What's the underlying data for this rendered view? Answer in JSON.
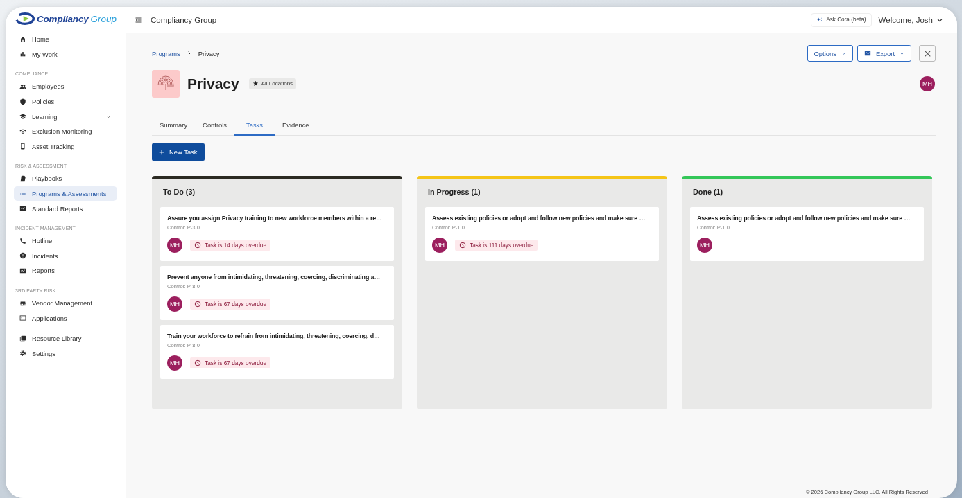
{
  "logo": {
    "word_1": "Compliancy",
    "word_2": "Group"
  },
  "sidebar": {
    "sections": [
      {
        "items": [
          {
            "label": "Home",
            "selected": false
          },
          {
            "label": "My Work",
            "selected": false
          }
        ]
      },
      {
        "heading": "COMPLIANCE",
        "items": [
          {
            "label": "Employees",
            "selected": false
          },
          {
            "label": "Policies",
            "selected": false
          },
          {
            "label": "Learning",
            "selected": false,
            "expanded": false
          },
          {
            "label": "Exclusion Monitoring",
            "selected": false
          },
          {
            "label": "Asset Tracking",
            "selected": false
          }
        ]
      },
      {
        "heading": "RISK & ASSESSMENT",
        "items": [
          {
            "label": "Playbooks",
            "selected": false
          },
          {
            "label": "Programs & Assessments",
            "selected": true
          },
          {
            "label": "Standard Reports",
            "selected": false
          }
        ]
      },
      {
        "heading": "INCIDENT MANAGEMENT",
        "items": [
          {
            "label": "Hotline",
            "selected": false
          },
          {
            "label": "Incidents",
            "selected": false
          },
          {
            "label": "Reports",
            "selected": false
          }
        ]
      },
      {
        "heading": "3RD PARTY RISK",
        "items": [
          {
            "label": "Vendor Management",
            "selected": false
          },
          {
            "label": "Applications",
            "selected": false
          }
        ]
      },
      {
        "items": [
          {
            "label": "Resource Library",
            "selected": false
          },
          {
            "label": "Settings",
            "selected": false
          }
        ]
      }
    ]
  },
  "topbar": {
    "title": "Compliancy Group",
    "ask_button": "Ask Cora (beta)",
    "user_menu": "Welcome, Josh"
  },
  "breadcrumb": [
    "Programs",
    "Privacy"
  ],
  "actions": {
    "options": "Options",
    "export": "Export"
  },
  "program": {
    "title": "Privacy",
    "badge": "All Locations",
    "owner": "MH"
  },
  "tabs": [
    {
      "label": "Summary",
      "selected": false
    },
    {
      "label": "Controls",
      "selected": false
    },
    {
      "label": "Tasks",
      "selected": true
    },
    {
      "label": "Evidence",
      "selected": false
    }
  ],
  "new_task_button": "New Task",
  "columns": [
    {
      "title": "To Do (3)",
      "color": "#2b2a22",
      "cards": [
        {
          "title": "Assure you assign Privacy training to new workforce members within a re…",
          "control": "Control: P-3.0",
          "assignee": "MH",
          "overdue": "Task is 14 days overdue"
        },
        {
          "title": "Prevent anyone from intimidating, threatening, coercing, discriminating a…",
          "control": "Control: P-8.0",
          "assignee": "MH",
          "overdue": "Task is 67 days overdue"
        },
        {
          "title": "Train your workforce to refrain from intimidating, threatening, coercing, d…",
          "control": "Control: P-8.0",
          "assignee": "MH",
          "overdue": "Task is 67 days overdue"
        }
      ]
    },
    {
      "title": "In Progress (1)",
      "color": "#f5c518",
      "cards": [
        {
          "title": "Assess existing policies or adopt and follow new policies and make sure …",
          "control": "Control: P-1.0",
          "assignee": "MH",
          "overdue": "Task is 111 days overdue"
        }
      ]
    },
    {
      "title": "Done (1)",
      "color": "#34c759",
      "cards": [
        {
          "title": "Assess existing policies or adopt and follow new policies and make sure …",
          "control": "Control: P-1.0",
          "assignee": "MH"
        }
      ]
    }
  ],
  "footer": "© 2026 Compliancy Group LLC. All Rights Reserved"
}
